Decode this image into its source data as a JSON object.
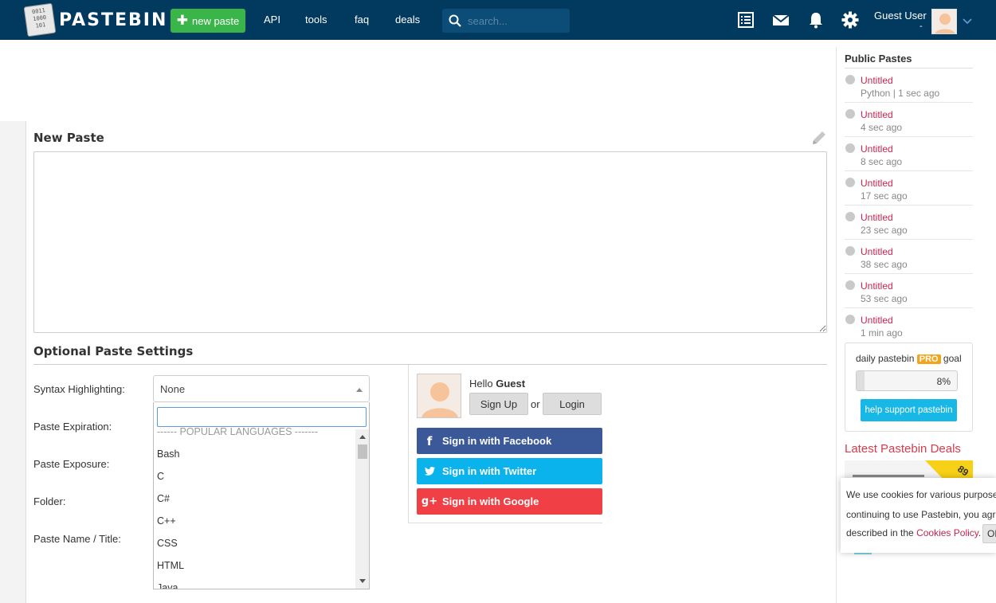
{
  "header": {
    "logo_text": "PASTEBIN",
    "logo_digits": [
      "0011",
      "1000",
      "101"
    ],
    "new_paste_label": "new paste",
    "nav": [
      "API",
      "tools",
      "faq",
      "deals"
    ],
    "search_placeholder": "search...",
    "user_name": "Guest User",
    "user_sub": "-",
    "colors": {
      "bar": "#02395f",
      "new_paste": "#3ab54a",
      "search_bg": "#0c4d78"
    }
  },
  "main": {
    "new_paste_title": "New Paste",
    "paste_content": "",
    "optional_settings_title": "Optional Paste Settings",
    "labels": {
      "syntax": "Syntax Highlighting:",
      "expiration": "Paste Expiration:",
      "exposure": "Paste Exposure:",
      "folder": "Folder:",
      "name": "Paste Name / Title:"
    },
    "syntax_select": {
      "selected": "None",
      "search_value": "",
      "group_label": "------ POPULAR LANGUAGES -------",
      "options": [
        "Bash",
        "C",
        "C#",
        "C++",
        "CSS",
        "HTML",
        "Java"
      ]
    }
  },
  "login": {
    "hello": "Hello",
    "guest": "Guest",
    "sign_up": "Sign Up",
    "or": "or",
    "login": "Login",
    "facebook": "Sign in with Facebook",
    "twitter": "Sign in with Twitter",
    "google": "Sign in with Google",
    "colors": {
      "facebook": "#3b5998",
      "twitter": "#1da1f2",
      "google": "#e84a4a"
    }
  },
  "sidebar": {
    "public_pastes_title": "Public Pastes",
    "pastes": [
      {
        "title": "Untitled",
        "meta": "Python | 1 sec ago"
      },
      {
        "title": "Untitled",
        "meta": "4 sec ago"
      },
      {
        "title": "Untitled",
        "meta": "8 sec ago"
      },
      {
        "title": "Untitled",
        "meta": "17 sec ago"
      },
      {
        "title": "Untitled",
        "meta": "23 sec ago"
      },
      {
        "title": "Untitled",
        "meta": "38 sec ago"
      },
      {
        "title": "Untitled",
        "meta": "53 sec ago"
      },
      {
        "title": "Untitled",
        "meta": "1 min ago"
      }
    ],
    "goal": {
      "prefix": "daily pastebin",
      "pro": "PRO",
      "suffix": "goal",
      "percent_text": "8%",
      "percent": 8,
      "support_label": "help support pastebin"
    },
    "deals_title": "Latest Pastebin Deals",
    "deal_badge": "89"
  },
  "cookie": {
    "line1": "We use cookies for various purposes",
    "line2": "continuing to use Pastebin, you agre",
    "line3_prefix": "described in the",
    "policy_link": "Cookies Policy",
    "line3_suffix": ".",
    "ok": "OK"
  }
}
